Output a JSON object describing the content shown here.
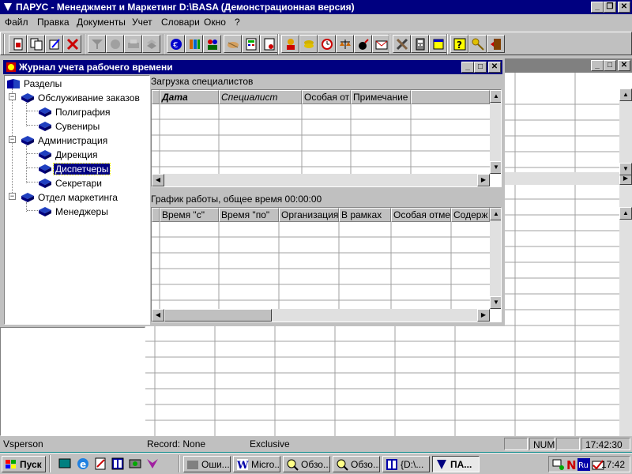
{
  "app": {
    "title": "ПАРУС - Менеджмент и Маркетинг  D:\\BASA (Демонстрационная версия)",
    "menu": [
      "Файл",
      "Правка",
      "Документы",
      "Учет",
      "Словари",
      "Окно",
      "?"
    ]
  },
  "child": {
    "title": "Журнал учета рабочего времени"
  },
  "tree": {
    "root": "Разделы",
    "groups": [
      {
        "label": "Обслуживание заказов",
        "items": [
          "Полиграфия",
          "Сувениры"
        ]
      },
      {
        "label": "Администрация",
        "items": [
          "Дирекция",
          "Диспетчеры",
          "Секретари"
        ]
      },
      {
        "label": "Отдел маркетинга",
        "items": [
          "Менеджеры"
        ]
      }
    ],
    "selected": "Диспетчеры"
  },
  "upper_grid": {
    "label": "Загрузка специалистов",
    "columns": [
      "Дата",
      "Специалист",
      "Особая от",
      "Примечание"
    ]
  },
  "lower_grid": {
    "label": "График работы, общее время 00:00:00",
    "columns": [
      "Время \"с\"",
      "Время \"по\"",
      "Организация",
      "В рамках",
      "Особая отме",
      "Содерж"
    ]
  },
  "status": {
    "user": "Vsperson",
    "record": "Record: None",
    "mode": "Exclusive",
    "num": "NUM",
    "time": "17:42:30"
  },
  "taskbar": {
    "start": "Пуск",
    "tasks": [
      "Оши...",
      "Micro...",
      "Обзо...",
      "Обзо...",
      "{D:\\...",
      "ПА..."
    ],
    "active_task": "ПА...",
    "clock": "17:42"
  },
  "colors": {
    "title_active": "#000080",
    "desktop": "#008080",
    "face": "#c0c0c0"
  }
}
